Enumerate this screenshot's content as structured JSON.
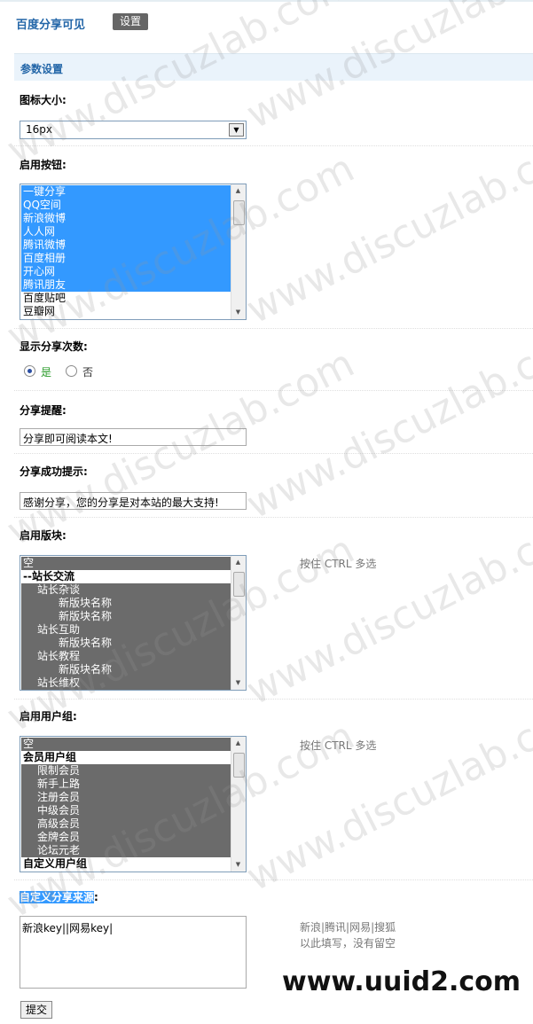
{
  "header": {
    "title": "百度分享可见",
    "settings_label": "设置"
  },
  "section": {
    "title": "参数设置"
  },
  "icon_size": {
    "label": "图标大小:",
    "value": "16px"
  },
  "buttons": {
    "label": "启用按钮:",
    "items": [
      {
        "text": "一键分享",
        "selected": true
      },
      {
        "text": "QQ空间",
        "selected": true
      },
      {
        "text": "新浪微博",
        "selected": true
      },
      {
        "text": "人人网",
        "selected": true
      },
      {
        "text": "腾讯微博",
        "selected": true
      },
      {
        "text": "百度相册",
        "selected": true
      },
      {
        "text": "开心网",
        "selected": true
      },
      {
        "text": "腾讯朋友",
        "selected": true
      },
      {
        "text": "百度贴吧",
        "selected": false
      },
      {
        "text": "豆瓣网",
        "selected": false
      }
    ]
  },
  "share_count": {
    "label": "显示分享次数:",
    "yes": "是",
    "no": "否",
    "selected": "yes"
  },
  "share_tip": {
    "label": "分享提醒:",
    "value": "分享即可阅读本文!"
  },
  "share_success": {
    "label": "分享成功提示:",
    "value": "感谢分享，您的分享是对本站的最大支持!"
  },
  "forums": {
    "label": "启用版块:",
    "hint": "按住 CTRL 多选",
    "items": [
      {
        "text": "空",
        "bold": false
      },
      {
        "text": "--站长交流",
        "bold": true
      },
      {
        "text": "站长杂谈",
        "bold": false
      },
      {
        "text": "新版块名称",
        "bold": false
      },
      {
        "text": "新版块名称",
        "bold": false
      },
      {
        "text": "站长互助",
        "bold": false
      },
      {
        "text": "新版块名称",
        "bold": false
      },
      {
        "text": "站长教程",
        "bold": false
      },
      {
        "text": "新版块名称",
        "bold": false
      },
      {
        "text": "站长维权",
        "bold": false
      }
    ]
  },
  "usergroups": {
    "label": "启用用户组:",
    "hint": "按住 CTRL 多选",
    "items": [
      {
        "text": "空",
        "bold": false
      },
      {
        "text": "会员用户组",
        "bold": true
      },
      {
        "text": "限制会员",
        "bold": false
      },
      {
        "text": "新手上路",
        "bold": false
      },
      {
        "text": "注册会员",
        "bold": false
      },
      {
        "text": "中级会员",
        "bold": false
      },
      {
        "text": "高级会员",
        "bold": false
      },
      {
        "text": "金牌会员",
        "bold": false
      },
      {
        "text": "论坛元老",
        "bold": false
      },
      {
        "text": "自定义用户组",
        "bold": true
      }
    ]
  },
  "custom_source": {
    "label": "自定义分享来源",
    "label_suffix": ":",
    "value": "新浪key||网易key|",
    "hint_line1": "新浪|腾讯|网易|搜狐",
    "hint_line2": "以此填写，没有留空"
  },
  "submit_label": "提交",
  "watermark_text": "www.discuzlab.com",
  "brand_text": "www.uuid2.com"
}
